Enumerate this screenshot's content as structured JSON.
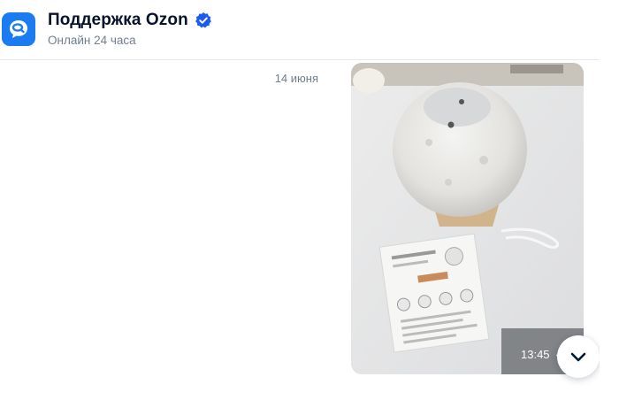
{
  "header": {
    "title": "Поддержка Ozon",
    "status": "Онлайн 24 часа",
    "avatar_icon": "chat-bubble-icon",
    "verified_icon": "verified-check-icon",
    "accent_color": "#1b7cf2"
  },
  "chat": {
    "date_separator": "14 июня",
    "messages": [
      {
        "type": "photo",
        "photo_description_icon": "product-photo",
        "time": "13:45",
        "status_icon": "check-icon"
      }
    ]
  },
  "controls": {
    "scroll_down_icon": "chevron-down-icon"
  }
}
